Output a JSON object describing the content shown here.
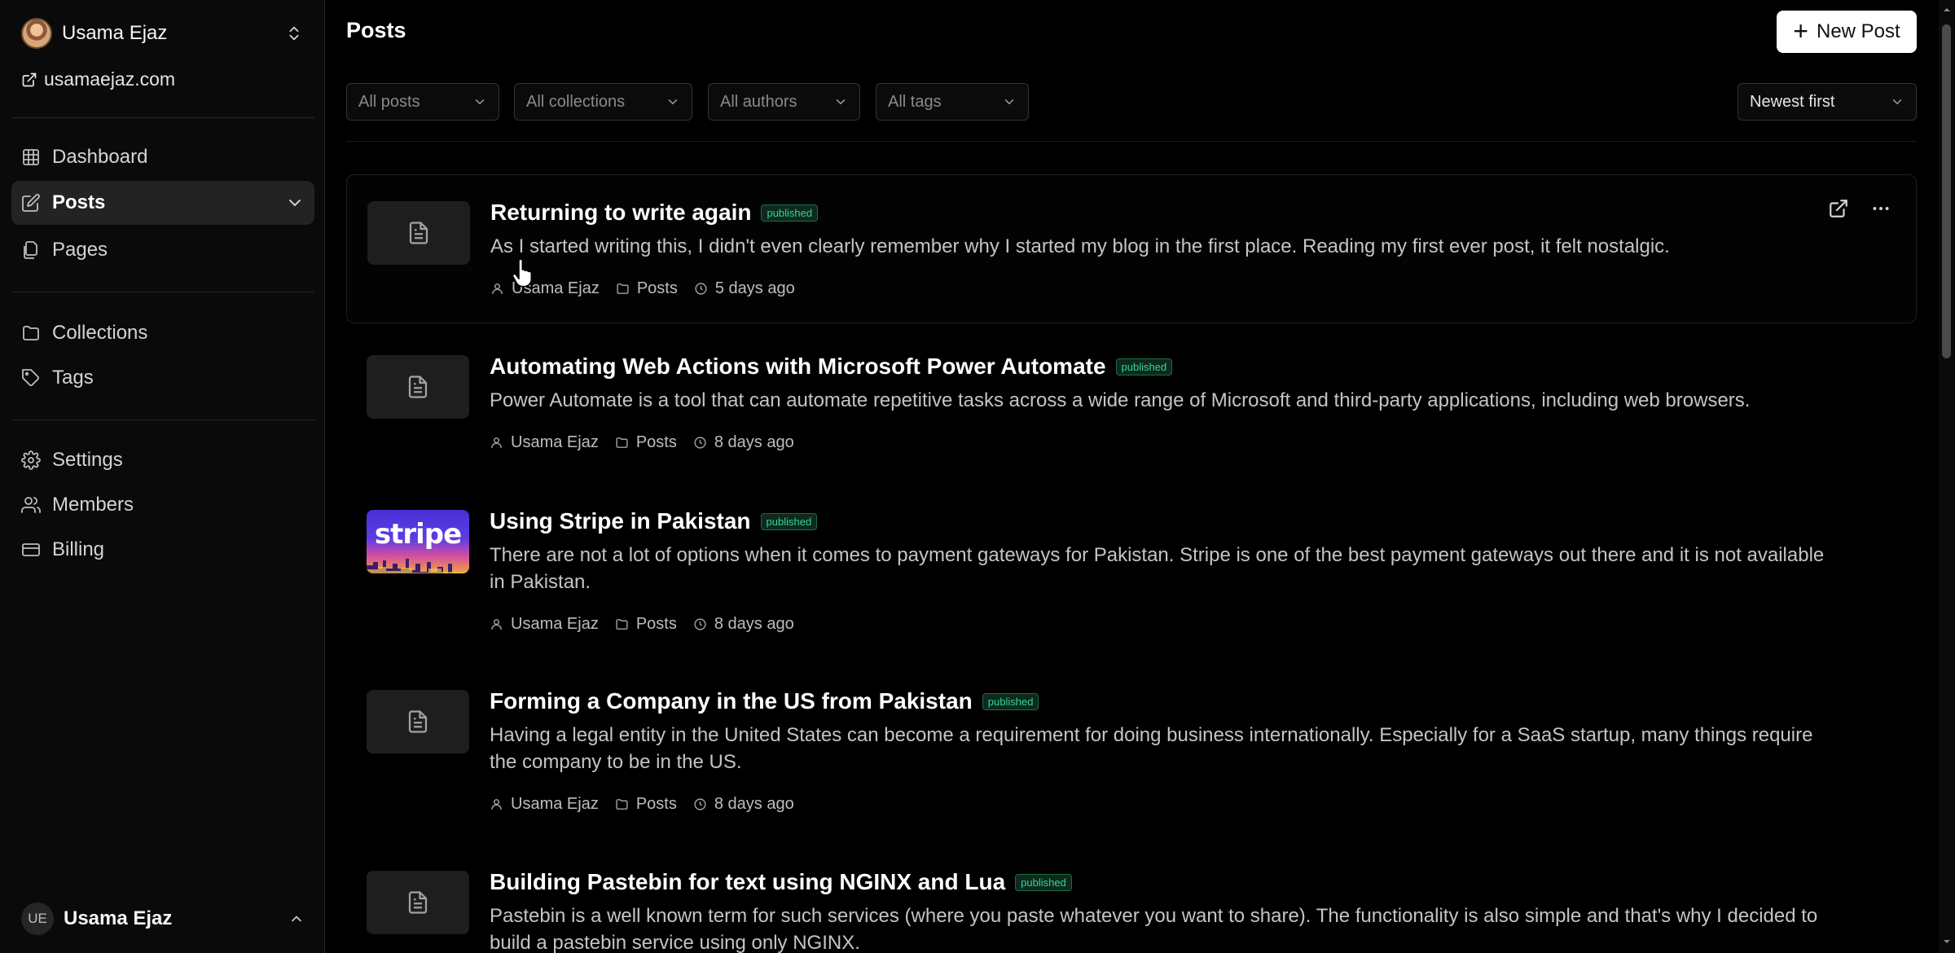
{
  "sidebar": {
    "profile": {
      "name": "Usama Ejaz"
    },
    "site_link": "usamaejaz.com",
    "nav": [
      {
        "label": "Dashboard",
        "icon": "grid-icon"
      },
      {
        "label": "Posts",
        "icon": "edit-icon",
        "active": true
      },
      {
        "label": "Pages",
        "icon": "files-icon"
      },
      {
        "label": "Collections",
        "icon": "folder-icon"
      },
      {
        "label": "Tags",
        "icon": "tag-icon"
      },
      {
        "label": "Settings",
        "icon": "gear-icon"
      },
      {
        "label": "Members",
        "icon": "users-icon"
      },
      {
        "label": "Billing",
        "icon": "card-icon"
      }
    ],
    "footer": {
      "initials": "UE",
      "name": "Usama Ejaz"
    }
  },
  "main": {
    "title": "Posts",
    "new_post_label": "New Post",
    "filters": {
      "status": "All posts",
      "collections": "All collections",
      "authors": "All authors",
      "tags": "All tags",
      "sort": "Newest first"
    },
    "posts": [
      {
        "title": "Returning to write again",
        "status": "published",
        "excerpt": "As I started writing this, I didn't even clearly remember why I started my blog in the first place. Reading my first ever post, it felt nostalgic.",
        "author": "Usama Ejaz",
        "collection": "Posts",
        "time": "5 days ago"
      },
      {
        "title": "Automating Web Actions with Microsoft Power Automate",
        "status": "published",
        "excerpt": "Power Automate is a tool that can automate repetitive tasks across a wide range of Microsoft and third-party applications, including web browsers.",
        "author": "Usama Ejaz",
        "collection": "Posts",
        "time": "8 days ago"
      },
      {
        "title": "Using Stripe in Pakistan",
        "status": "published",
        "excerpt": "There are not a lot of options when it comes to payment gateways for Pakistan. Stripe is one of the best payment gateways out there and it is not available in Pakistan.",
        "author": "Usama Ejaz",
        "collection": "Posts",
        "time": "8 days ago",
        "thumbnail_text": "stripe"
      },
      {
        "title": "Forming a Company in the US from Pakistan",
        "status": "published",
        "excerpt": "Having a legal entity in the United States can become a requirement for doing business internationally. Especially for a SaaS startup, many things require the company to be in the US.",
        "author": "Usama Ejaz",
        "collection": "Posts",
        "time": "8 days ago"
      },
      {
        "title": "Building Pastebin for text using NGINX and Lua",
        "status": "published",
        "excerpt": "Pastebin is a well known term for such services (where you paste whatever you want to share). The functionality is also simple and that's why I decided to build a pastebin service using only NGINX."
      }
    ]
  }
}
